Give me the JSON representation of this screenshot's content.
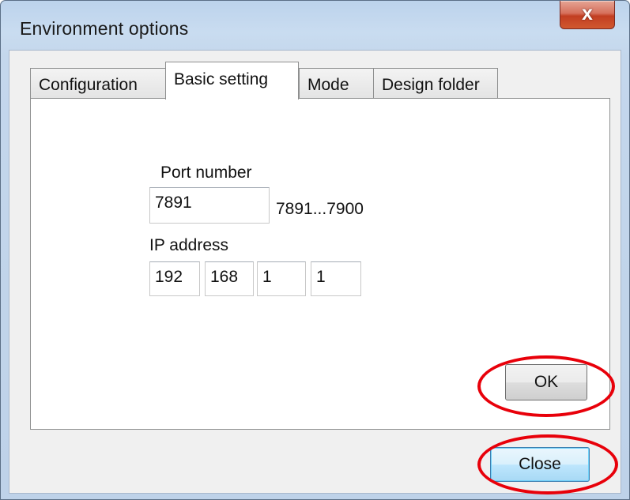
{
  "window": {
    "title": "Environment options",
    "close_glyph": "x"
  },
  "tabs": [
    {
      "label": "Configuration"
    },
    {
      "label": "Basic setting"
    },
    {
      "label": "Mode"
    },
    {
      "label": "Design folder"
    }
  ],
  "active_tab": "Basic setting",
  "basic_setting": {
    "port_label": "Port number",
    "port_value": "7891",
    "port_range": "7891...7900",
    "ip_label": "IP address",
    "ip_octets": [
      "192",
      "168",
      "1",
      "1"
    ]
  },
  "buttons": {
    "ok": "OK",
    "close": "Close"
  },
  "colors": {
    "highlight_ring": "#e8000a",
    "title_close": "#c23e22"
  },
  "icons": {
    "title_close": "close-icon"
  }
}
